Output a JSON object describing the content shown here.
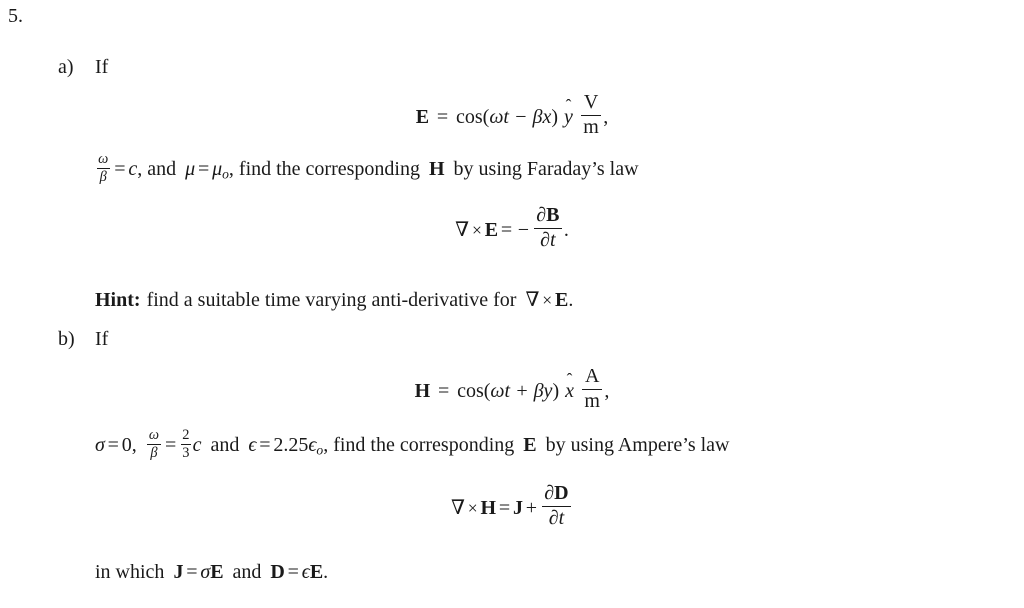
{
  "document": {
    "problem_number": "5.",
    "background_color": "#ffffff",
    "text_color": "#1a1a1a"
  },
  "parts": [
    {
      "marker": "a)",
      "lead": "If",
      "equation_1": {
        "lhs": "E",
        "relation": "=",
        "rhs_function": "cos",
        "argument": "ωt − βx",
        "unit_vector": "ŷ",
        "unit_numerator": "V",
        "unit_denominator": "m",
        "trailing": ","
      },
      "conditions": {
        "omega_over_beta_num": "ω",
        "omega_over_beta_den": "β",
        "equals": "=",
        "speed": "c",
        "comma_and": ", and",
        "mu": "μ",
        "mu_sub": "o",
        "tail": ", find the corresponding",
        "target_field": "H",
        "law_text": "by using Faraday’s law"
      },
      "equation_2": {
        "nabla": "∇",
        "cross": "×",
        "field": "E",
        "relation": "=",
        "sign": "−",
        "num_partial": "∂",
        "num_field": "B",
        "den_partial": "∂",
        "den_var": "t",
        "trailing": "."
      },
      "hint": {
        "label": "Hint:",
        "text": "find a suitable time varying anti-derivative for",
        "expr_nabla": "∇",
        "expr_cross": "×",
        "expr_field": "E",
        "expr_trailing": "."
      }
    },
    {
      "marker": "b)",
      "lead": "If",
      "equation_1": {
        "lhs": "H",
        "relation": "=",
        "rhs_function": "cos",
        "argument": "ωt + βy",
        "unit_vector": "x̂",
        "unit_numerator": "A",
        "unit_denominator": "m",
        "trailing": ","
      },
      "conditions": {
        "sigma": "σ",
        "sigma_equals": "=",
        "sigma_value": "0,",
        "omega_over_beta_num": "ω",
        "omega_over_beta_den": "β",
        "equals": "=",
        "frac_num": "2",
        "frac_den": "3",
        "speed": "c",
        "and": "and",
        "epsilon": "ϵ",
        "eps_equals": "=",
        "eps_value": "2.25",
        "eps_symbol": "ϵ",
        "eps_sub": "o",
        "tail": ", find the corresponding",
        "target_field": "E",
        "law_text": "by using Ampere’s law"
      },
      "equation_2": {
        "nabla": "∇",
        "cross": "×",
        "field": "H",
        "relation": "=",
        "current": "J",
        "plus": "+",
        "num_partial": "∂",
        "num_field": "D",
        "den_partial": "∂",
        "den_var": "t"
      },
      "closing": {
        "prefix": "in which",
        "j_field": "J",
        "j_equals": "=",
        "j_sigma": "σ",
        "j_e": "E",
        "and": "and",
        "d_field": "D",
        "d_equals": "=",
        "d_eps": "ϵ",
        "d_e": "E",
        "period": "."
      }
    }
  ]
}
